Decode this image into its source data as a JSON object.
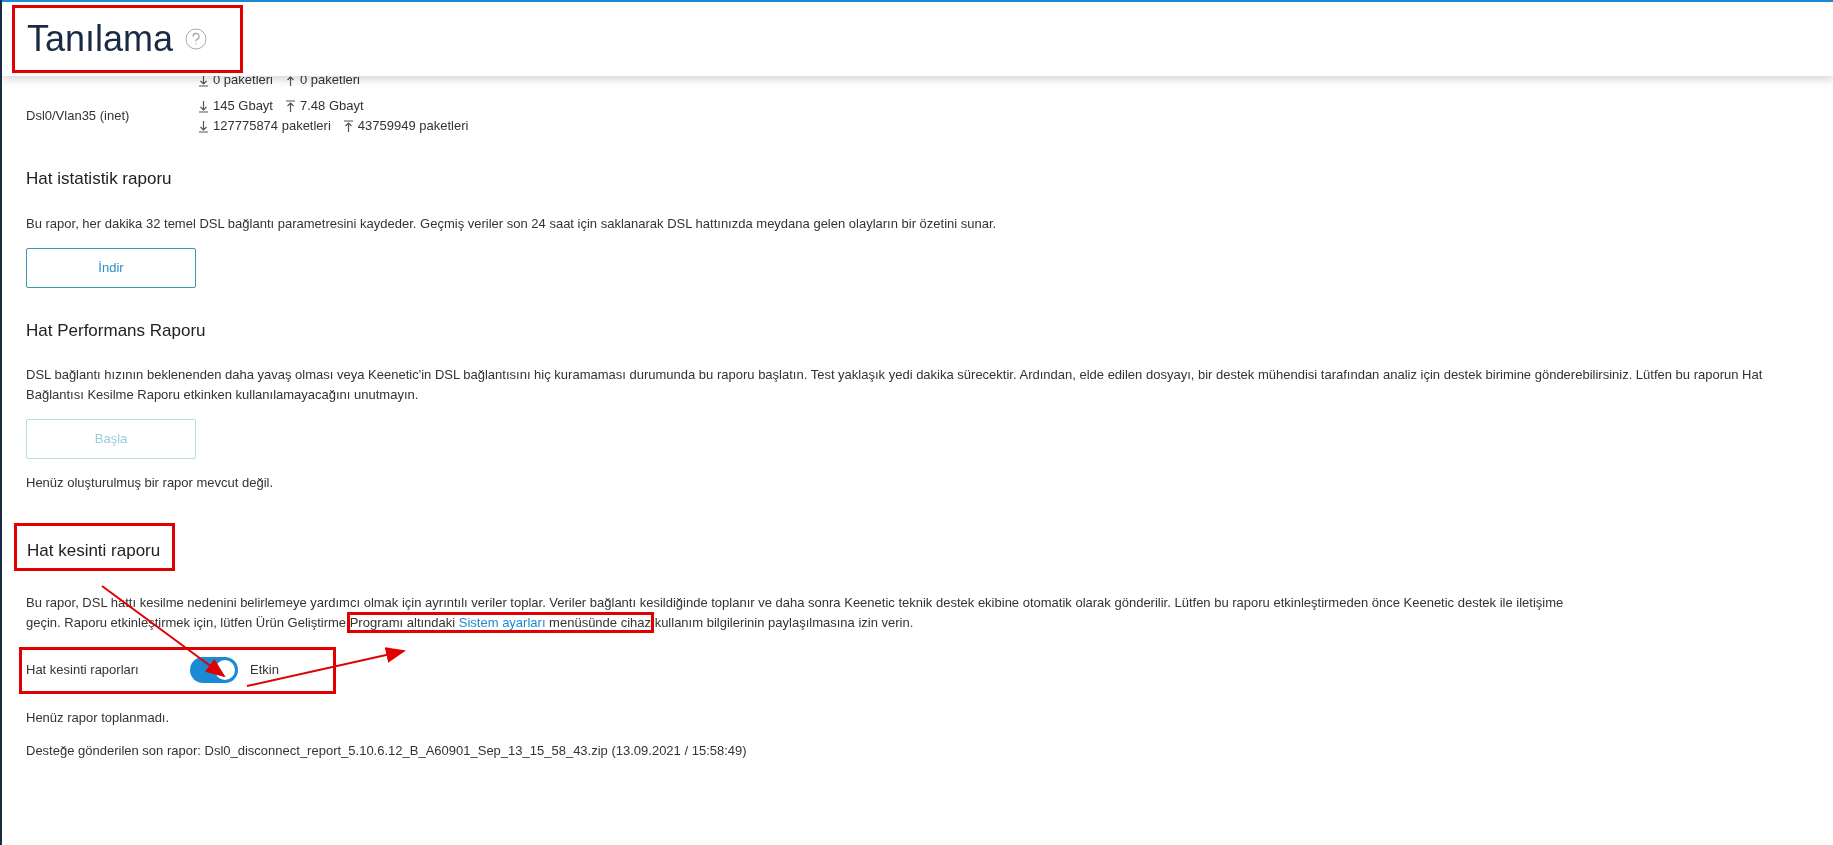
{
  "header": {
    "title": "Tanılama"
  },
  "interfaces": [
    {
      "lines": [
        {
          "down": "0 paketleri",
          "up": "0 paketleri"
        }
      ]
    },
    {
      "name": "Dsl0/Vlan35 (inet)",
      "lines": [
        {
          "down": "145 Gbayt",
          "up": "7.48 Gbayt"
        },
        {
          "down": "127775874 paketleri",
          "up": "43759949 paketleri"
        }
      ]
    }
  ],
  "sections": [
    {
      "title": "Hat istatistik raporu",
      "text": "Bu rapor, her dakika 32 temel DSL bağlantı parametresini kaydeder. Geçmiş veriler son 24 saat için saklanarak DSL hattınızda meydana gelen olayların bir özetini sunar.",
      "button": {
        "label": "İndir",
        "disabled": false
      }
    },
    {
      "title": "Hat Performans Raporu",
      "text": "DSL bağlantı hızının beklenenden daha yavaş olması veya Keenetic'in DSL bağlantısını hiç kuramaması durumunda bu raporu başlatın. Test yaklaşık yedi dakika sürecektir. Ardından, elde edilen dosyayı, bir destek mühendisi tarafından analiz için destek birimine gönderebilirsiniz. Lütfen bu raporun Hat Bağlantısı Kesilme Raporu etkinken kullanılamayacağını unutmayın.",
      "button": {
        "label": "Başla",
        "disabled": true
      },
      "notes": [
        "Henüz oluşturulmuş bir rapor mevcut değil."
      ]
    },
    {
      "title": "Hat kesinti raporu",
      "text": "Bu rapor, DSL hattı kesilme nedenini belirlemeye yardımcı olmak için ayrıntılı veriler toplar. Veriler bağlantı kesildiğinde toplanır ve daha sonra Keenetic teknik destek ekibine otomatik olarak gönderilir. Lütfen bu raporu etkinleştirmeden önce Keenetic destek ile iletişime geçin. Raporu etkinleştirmek için, lütfen Ürün Geliştirme ",
      "text_marked": "Programı altındaki ",
      "link": "Sistem ayarları",
      "text_marked_after": " menüsünde cihaz",
      "text_after": " kullanım bilgilerinin paylaşılmasına izin verin.",
      "toggle": {
        "label": "Hat kesinti raporları",
        "on": true,
        "state": "Etkin"
      },
      "notes": [
        "Henüz rapor toplanmadı.",
        "Desteğe gönderilen son rapor: Dsl0_disconnect_report_5.10.6.12_B_A60901_Sep_13_15_58_43.zip (13.09.2021 / 15:58:49)"
      ]
    }
  ]
}
